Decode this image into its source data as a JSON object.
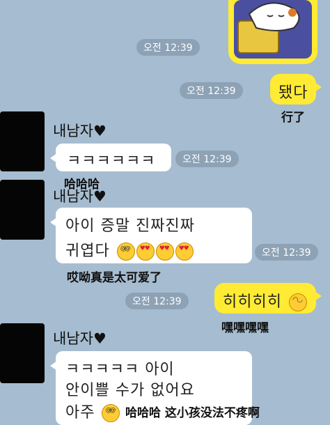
{
  "time_label": "오전 12:39",
  "sender_name": "내남자♥",
  "messages": {
    "sticker": {
      "caption": ""
    },
    "m1": {
      "text": "됐다",
      "caption": "行了"
    },
    "m2": {
      "text": "ㅋㅋㅋㅋㅋㅋ",
      "caption": "哈哈哈"
    },
    "m3": {
      "line1": "아이 증말 진짜진짜",
      "line2": "귀엽다",
      "caption": "哎呦真是太可爱了"
    },
    "m4": {
      "text": "히히히히",
      "caption": "嘿嘿嘿嘿"
    },
    "m5": {
      "line1": "ㅋㅋㅋㅋㅋ 아이",
      "line2": "안이쁠 수가 없어요",
      "line3": "아주",
      "caption": "哈哈哈 这小孩没法不疼啊"
    }
  },
  "icons": [
    "sleeping-cat-sticker",
    "dizzy-emoji",
    "heart-eyes-emoji",
    "wink-emoji"
  ],
  "colors": {
    "background": "#a6bcd0",
    "my_bubble": "#ffeb33",
    "their_bubble": "#ffffff",
    "avatar": "#050505"
  }
}
